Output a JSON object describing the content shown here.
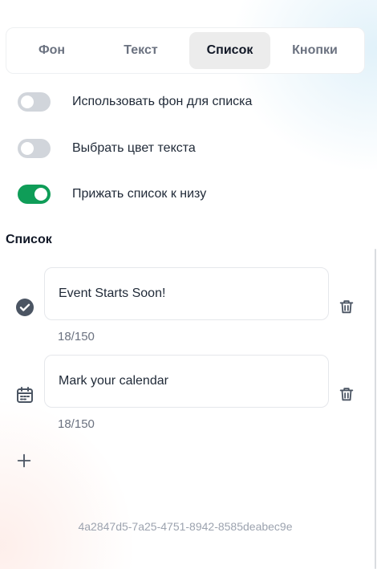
{
  "tabs": [
    {
      "label": "Фон"
    },
    {
      "label": "Текст"
    },
    {
      "label": "Список"
    },
    {
      "label": "Кнопки"
    }
  ],
  "active_tab": "Список",
  "toggles": [
    {
      "label": "Использовать фон для списка",
      "on": false
    },
    {
      "label": "Выбрать цвет текста",
      "on": false
    },
    {
      "label": "Прижать список к низу",
      "on": true
    }
  ],
  "section": {
    "title": "Список"
  },
  "items": [
    {
      "icon": "check-circle-icon",
      "text": "Event Starts Soon!",
      "counter": "18/150"
    },
    {
      "icon": "calendar-icon",
      "text": "Mark your calendar",
      "counter": "18/150"
    }
  ],
  "uuid": "4a2847d5-7a25-4751-8942-8585deabec9e",
  "colors": {
    "accent": "#0f9d58",
    "active_tab_bg": "#ececec",
    "toggle_off": "#d1d5db"
  }
}
